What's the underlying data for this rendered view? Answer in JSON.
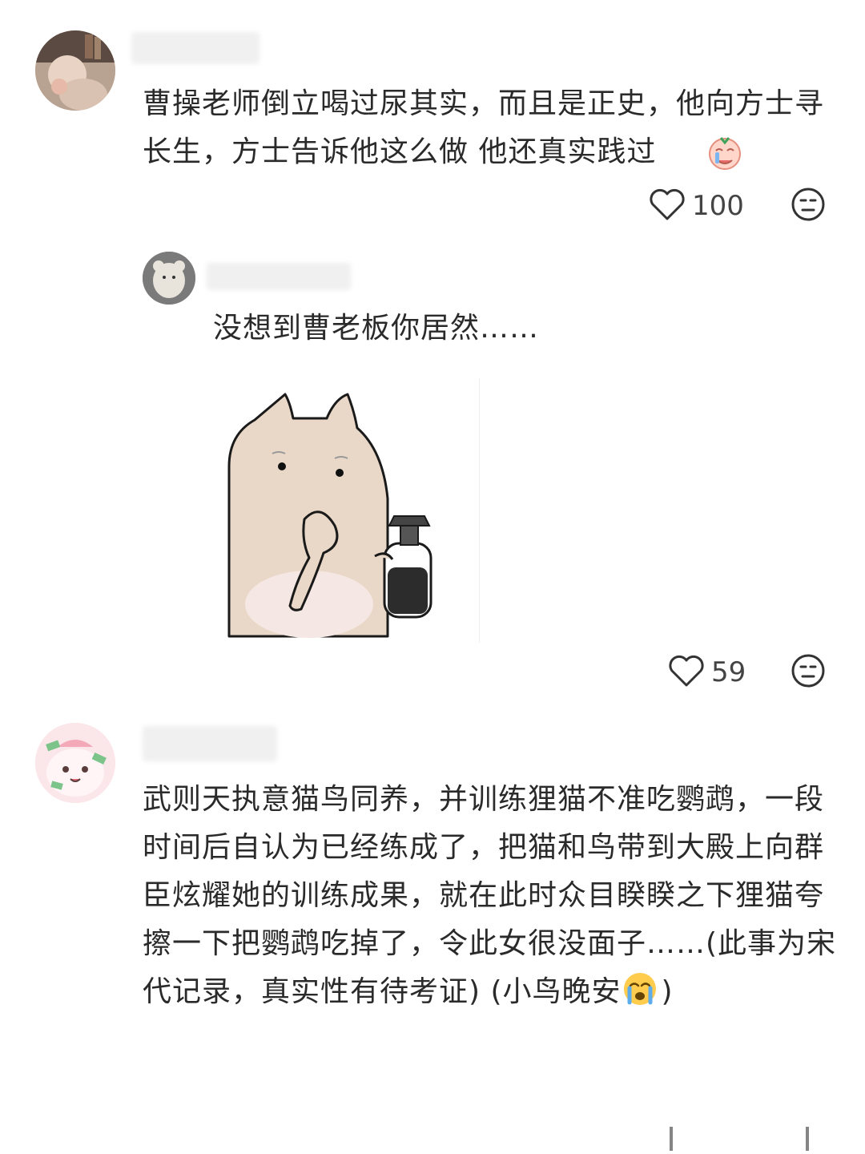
{
  "comments": [
    {
      "text": "曹操老师倒立喝过尿其实，而且是正史，他向方士寻长生，方士告诉他这么做 他还真实践过",
      "likes": "100"
    },
    {
      "text": "没想到曹老板你居然……",
      "likes": "59"
    },
    {
      "text": "武则天执意猫鸟同养，并训练狸猫不准吃鹦鹉，一段时间后自认为已经练成了，把猫和鸟带到大殿上向群臣炫耀她的训练成果，就在此时众目睽睽之下狸猫夸擦一下把鹦鹉吃掉了，令此女很没面子……(此事为宋代记录，真实性有待考证) (小鸟晚安",
      "text_tail": ")"
    }
  ]
}
